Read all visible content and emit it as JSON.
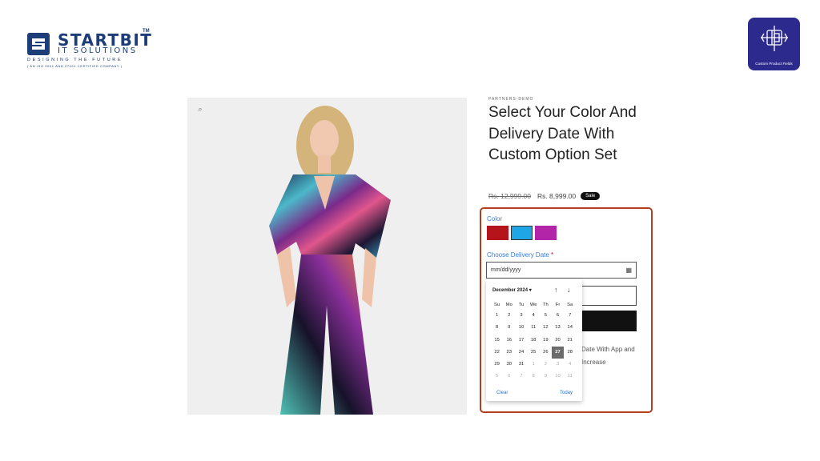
{
  "logo": {
    "brand": "STARTBIT",
    "tm": "TM",
    "sub": "IT SOLUTIONS",
    "tagline": "DESIGNING THE FUTURE",
    "cert": "( AN ISO 9001 AND 27001 CERTIFIED COMPANY )"
  },
  "app_icon": {
    "name": "Custom Product Fields",
    "color": "#2c2a8c"
  },
  "product": {
    "vendor": "PARTNERS-DEMO",
    "title": "Select Your Color And Delivery Date With Custom Option Set",
    "old_price": "Rs. 12,999.00",
    "price": "Rs. 8,999.00",
    "badge": "Sale",
    "zoom_icon": "zoom-icon"
  },
  "options": {
    "color_label": "Color",
    "swatches": [
      {
        "name": "red",
        "color": "#b5141d"
      },
      {
        "name": "blue",
        "color": "#1ea6e6"
      },
      {
        "name": "purple",
        "color": "#b325a8"
      }
    ],
    "date_label": "Choose Delivery Date",
    "required_mark": "*",
    "date_placeholder": "mm/dd/yyyy",
    "description": "Date With App and Increase",
    "border_color": "#b04020"
  },
  "datepicker": {
    "month": "December 2024 ▾",
    "up": "↑",
    "down": "↓",
    "weekdays": [
      "Su",
      "Mo",
      "Tu",
      "We",
      "Th",
      "Fr",
      "Sa"
    ],
    "weeks": [
      [
        "1",
        "2",
        "3",
        "4",
        "5",
        "6",
        "7"
      ],
      [
        "8",
        "9",
        "10",
        "11",
        "12",
        "13",
        "14"
      ],
      [
        "15",
        "16",
        "17",
        "18",
        "19",
        "20",
        "21"
      ],
      [
        "22",
        "23",
        "24",
        "25",
        "26",
        "27",
        "28"
      ],
      [
        "29",
        "30",
        "31",
        "1",
        "2",
        "3",
        "4"
      ],
      [
        "5",
        "6",
        "7",
        "8",
        "9",
        "10",
        "11"
      ]
    ],
    "selected": "27",
    "clear": "Clear",
    "today": "Today"
  }
}
